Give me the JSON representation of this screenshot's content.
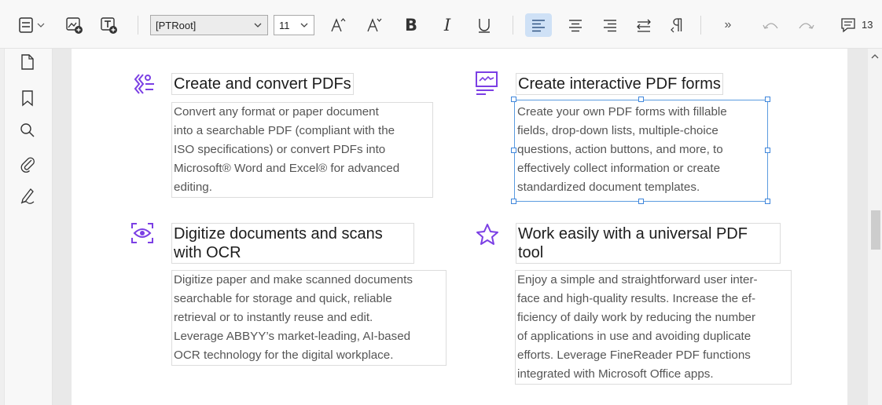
{
  "toolbar": {
    "font_name": "[PTRoot]",
    "font_size": "11",
    "comment_count": "13",
    "icons": [
      "page-layout-icon",
      "insert-image-icon",
      "insert-text-icon",
      "increase-font-icon",
      "decrease-font-icon",
      "bold-icon",
      "italic-icon",
      "underline-icon",
      "align-left-icon",
      "align-center-icon",
      "align-right-icon",
      "text-direction-icon",
      "paragraph-icon",
      "more-icon",
      "undo-icon",
      "redo-icon",
      "comments-icon"
    ]
  },
  "sidebar": {
    "icons": [
      "pages-icon",
      "bookmarks-icon",
      "search-icon",
      "attachments-icon",
      "signatures-icon"
    ]
  },
  "features": [
    {
      "icon": "convert-icon",
      "title": "Create and convert PDFs",
      "lines": [
        "Convert any format or paper document",
        "into a searchable PDF (compliant with the",
        "ISO specifications) or convert PDFs into",
        "Microsoft® Word and Excel® for advanced",
        "editing."
      ]
    },
    {
      "icon": "form-icon",
      "title": "Create interactive PDF forms",
      "lines": [
        "Create your own PDF forms with fillable",
        "fields, drop-down lists, multiple-choice",
        "questions, action buttons, and more, to",
        "effectively collect information or create",
        "standardized document templates."
      ]
    },
    {
      "icon": "ocr-eye-icon",
      "title_lines": [
        "Digitize documents and scans",
        "with OCR"
      ],
      "lines": [
        "Digitize paper and make scanned documents",
        "searchable for storage and quick, reliable",
        "retrieval or to instantly reuse and edit.",
        "Leverage ABBYY’s market-leading, AI-based",
        "OCR technology for the digital workplace."
      ]
    },
    {
      "icon": "star-icon",
      "title_lines": [
        "Work easily with a universal PDF",
        "tool"
      ],
      "lines": [
        "Enjoy a simple and straightforward user inter-",
        "face and high-quality results. Increase the ef-",
        "ficiency of daily work by reducing the number",
        "of applications in use and avoiding duplicate",
        "efforts. Leverage FineReader PDF functions",
        "integrated with Microsoft Office apps."
      ]
    }
  ],
  "colors": {
    "accent": "#7b3fe4",
    "selection": "#3f86db",
    "active_button": "#cfe1f6"
  }
}
